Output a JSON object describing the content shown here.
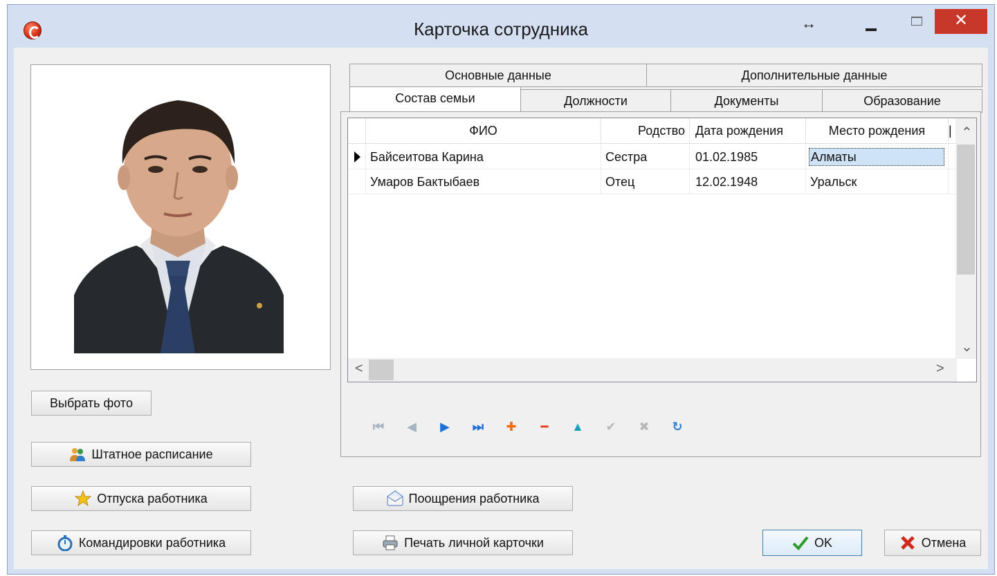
{
  "window": {
    "title": "Карточка сотрудника"
  },
  "titlebar_icons": [
    "resize-icon",
    "minimize-icon",
    "maximize-icon",
    "close-icon"
  ],
  "titlebar_glyphs": {
    "resize": "↔",
    "close": "✕"
  },
  "tabs_row1": [
    "Основные данные",
    "Дополнительные данные"
  ],
  "tabs_row2": [
    "Состав семьи",
    "Должности",
    "Документы",
    "Образование"
  ],
  "active_tab": "Состав семьи",
  "grid": {
    "columns": [
      "ФИО",
      "Родство",
      "Дата рождения",
      "Место рождения"
    ],
    "rows": [
      [
        "Байсеитова Карина",
        "Сестра",
        "01.02.1985",
        "Алматы"
      ],
      [
        "Умаров Бактыбаев",
        "Отец",
        "12.02.1948",
        "Уральск"
      ]
    ],
    "current_row": 0,
    "scroll_glyphs": {
      "up": "⌃",
      "down": "⌄",
      "left": "<",
      "right": ">"
    }
  },
  "navigator": [
    {
      "name": "first-record-icon",
      "glyph": "⏮",
      "color": "#a8b4c4"
    },
    {
      "name": "prior-record-icon",
      "glyph": "◀",
      "color": "#a8b4c4"
    },
    {
      "name": "next-record-icon",
      "glyph": "▶",
      "color": "#1e6fd6"
    },
    {
      "name": "last-record-icon",
      "glyph": "⏭",
      "color": "#1e6fd6"
    },
    {
      "name": "insert-record-icon",
      "glyph": "✚",
      "color": "#f06a10"
    },
    {
      "name": "delete-record-icon",
      "glyph": "━",
      "color": "#e8401c"
    },
    {
      "name": "edit-record-icon",
      "glyph": "▲",
      "color": "#1aa0b8"
    },
    {
      "name": "post-record-icon",
      "glyph": "✔",
      "color": "#b8b8b8"
    },
    {
      "name": "cancel-record-icon",
      "glyph": "✖",
      "color": "#b8b8b8"
    },
    {
      "name": "refresh-record-icon",
      "glyph": "↻",
      "color": "#2a7fd0"
    }
  ],
  "buttons": {
    "choose_photo": "Выбрать фото",
    "staffing": "Штатное расписание",
    "vacations": "Отпуска работника",
    "trips": "Командировки работника",
    "rewards": "Поощрения работника",
    "print_card": "Печать личной карточки",
    "ok": "OK",
    "cancel": "Отмена"
  },
  "colors": {
    "titlebar": "#d4dff1",
    "close": "#c8382a",
    "selection": "#cfe3f7",
    "ok_border": "#3c7fb1"
  }
}
